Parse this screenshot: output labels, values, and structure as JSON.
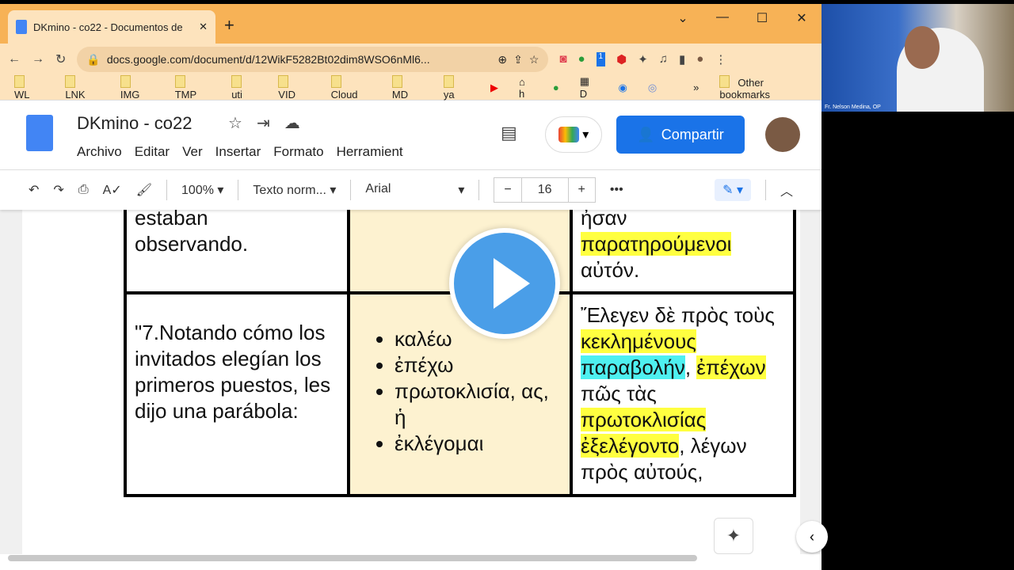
{
  "browser": {
    "tab_title": "DKmino - co22 - Documentos de",
    "url": "docs.google.com/document/d/12WikF5282Bt02dim8WSO6nMl6...",
    "extension_badge": "1",
    "bookmarks": [
      "WL",
      "LNK",
      "IMG",
      "TMP",
      "uti",
      "VID",
      "Cloud",
      "MD",
      "ya",
      "h",
      "D"
    ],
    "other_bookmarks": "Other bookmarks"
  },
  "doc": {
    "title": "DKmino - co22",
    "menu": [
      "Archivo",
      "Editar",
      "Ver",
      "Insertar",
      "Formato",
      "Herramient"
    ],
    "share_label": "Compartir"
  },
  "toolbar": {
    "zoom": "100%",
    "style": "Texto norm...",
    "font": "Arial",
    "font_size": "16"
  },
  "table": {
    "row1": {
      "spanish": [
        "estaban",
        "observando."
      ],
      "greek": [
        "ἦσαν",
        "παρατηρούμενοι",
        "αὐτόν."
      ]
    },
    "row2": {
      "spanish": "\"7.Notando cómo los invitados elegían los primeros puestos, les dijo una parábola:",
      "vocab": [
        "καλέω",
        "ἐπέχω",
        "πρωτοκλισία, ας, ἡ",
        "ἐκλέγομαι"
      ],
      "greek": {
        "t1": "Ἔλεγεν δὲ πρὸς τοὺς ",
        "h1": "κεκλημένους",
        "c1": "παραβολήν",
        "t2": ", ",
        "h2": "ἐπέχων",
        "t3": " πῶς τὰς ",
        "h3": "πρωτοκλισίας",
        "h4": "ἐξελέγοντο",
        "t4": ", λέγων πρὸς αὐτούς,"
      }
    }
  },
  "webcam": {
    "label": "Fr. Nelson Medina, OP"
  },
  "colors": {
    "highlight_yellow": "#ffff40",
    "highlight_cyan": "#4ef0f0",
    "share_blue": "#1a73e8",
    "tabbar": "#f7b256",
    "vocab_cell": "#fdf2d0",
    "play": "#4a9ee8"
  }
}
